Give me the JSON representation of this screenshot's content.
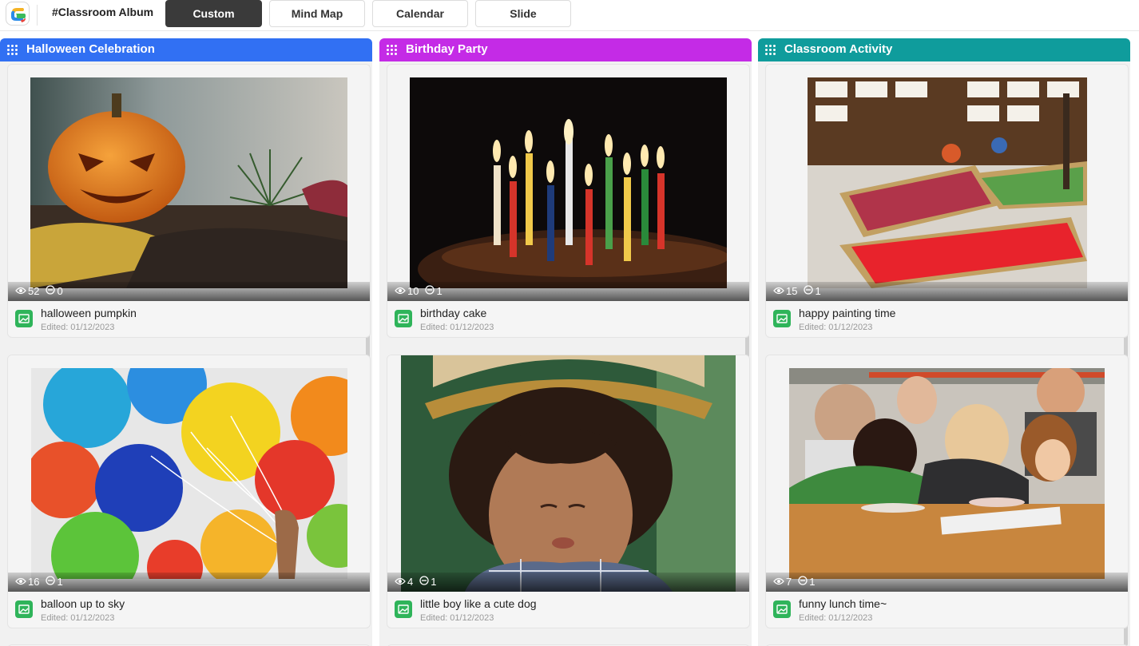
{
  "header": {
    "app_icon": "classroom-album-logo",
    "album_title": "#Classroom Album",
    "tabs": [
      {
        "label": "Custom",
        "active": true
      },
      {
        "label": "Mind Map",
        "active": false
      },
      {
        "label": "Calendar",
        "active": false
      },
      {
        "label": "Slide",
        "active": false
      }
    ]
  },
  "columns": [
    {
      "title": "Halloween Celebration",
      "color": "#3170f3",
      "cards": [
        {
          "title": "halloween pumpkin",
          "edited": "Edited: 01/12/2023",
          "views": "52",
          "comments": "0",
          "photo": "halloween-pumpkin-photo"
        },
        {
          "title": "balloon up to sky",
          "edited": "Edited: 01/12/2023",
          "views": "16",
          "comments": "1",
          "photo": "colorful-balloons-photo"
        }
      ]
    },
    {
      "title": "Birthday Party",
      "color": "#c42be6",
      "cards": [
        {
          "title": "birthday cake",
          "edited": "Edited: 01/12/2023",
          "views": "10",
          "comments": "1",
          "photo": "birthday-candles-photo"
        },
        {
          "title": "little boy like a cute dog",
          "edited": "Edited: 01/12/2023",
          "views": "4",
          "comments": "1",
          "photo": "boy-party-hat-photo"
        }
      ]
    },
    {
      "title": "Classroom Activity",
      "color": "#0f9c9c",
      "cards": [
        {
          "title": "happy painting time",
          "edited": "Edited: 01/12/2023",
          "views": "15",
          "comments": "1",
          "photo": "paint-trays-photo"
        },
        {
          "title": "funny lunch time~",
          "edited": "Edited: 01/12/2023",
          "views": "7",
          "comments": "1",
          "photo": "pie-eating-contest-photo"
        }
      ]
    }
  ]
}
